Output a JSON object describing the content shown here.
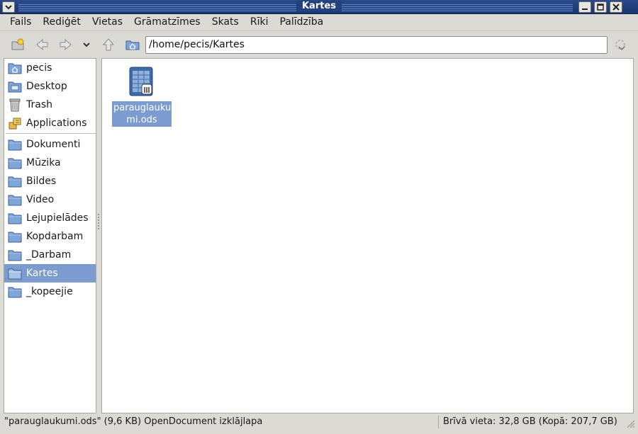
{
  "window": {
    "title": "Kartes"
  },
  "menu": [
    "Fails",
    "Rediģēt",
    "Vietas",
    "Grāmatzīmes",
    "Skats",
    "Rīki",
    "Palīdzība"
  ],
  "location": {
    "path": "/home/pecis/Kartes"
  },
  "sidebar": {
    "places": [
      {
        "label": "pecis",
        "icon": "home-folder-icon"
      },
      {
        "label": "Desktop",
        "icon": "desktop-icon"
      },
      {
        "label": "Trash",
        "icon": "trash-icon"
      },
      {
        "label": "Applications",
        "icon": "applications-icon"
      }
    ],
    "bookmarks": [
      {
        "label": "Dokumenti",
        "icon": "folder-icon"
      },
      {
        "label": "Mūzika",
        "icon": "folder-icon"
      },
      {
        "label": "Bildes",
        "icon": "folder-icon"
      },
      {
        "label": "Video",
        "icon": "folder-icon"
      },
      {
        "label": "Lejupielādes",
        "icon": "folder-icon"
      },
      {
        "label": "Kopdarbam",
        "icon": "folder-icon"
      },
      {
        "label": "_Darbam",
        "icon": "folder-icon"
      },
      {
        "label": "Kartes",
        "icon": "folder-icon",
        "selected": true
      },
      {
        "label": "_kopeejie",
        "icon": "folder-icon"
      }
    ]
  },
  "files": [
    {
      "name_line1": "parauglauku",
      "name_line2": "mi.ods",
      "icon": "spreadsheet-icon",
      "selected": true
    }
  ],
  "status": {
    "left": "\"parauglaukumi.ods\" (9,6 KB) OpenDocument izklājlapa",
    "right": "Brīvā vieta: 32,8 GB (Kopā: 207,7 GB)"
  },
  "colors": {
    "selection": "#7c9bcf",
    "titlebar": "#23417e"
  }
}
